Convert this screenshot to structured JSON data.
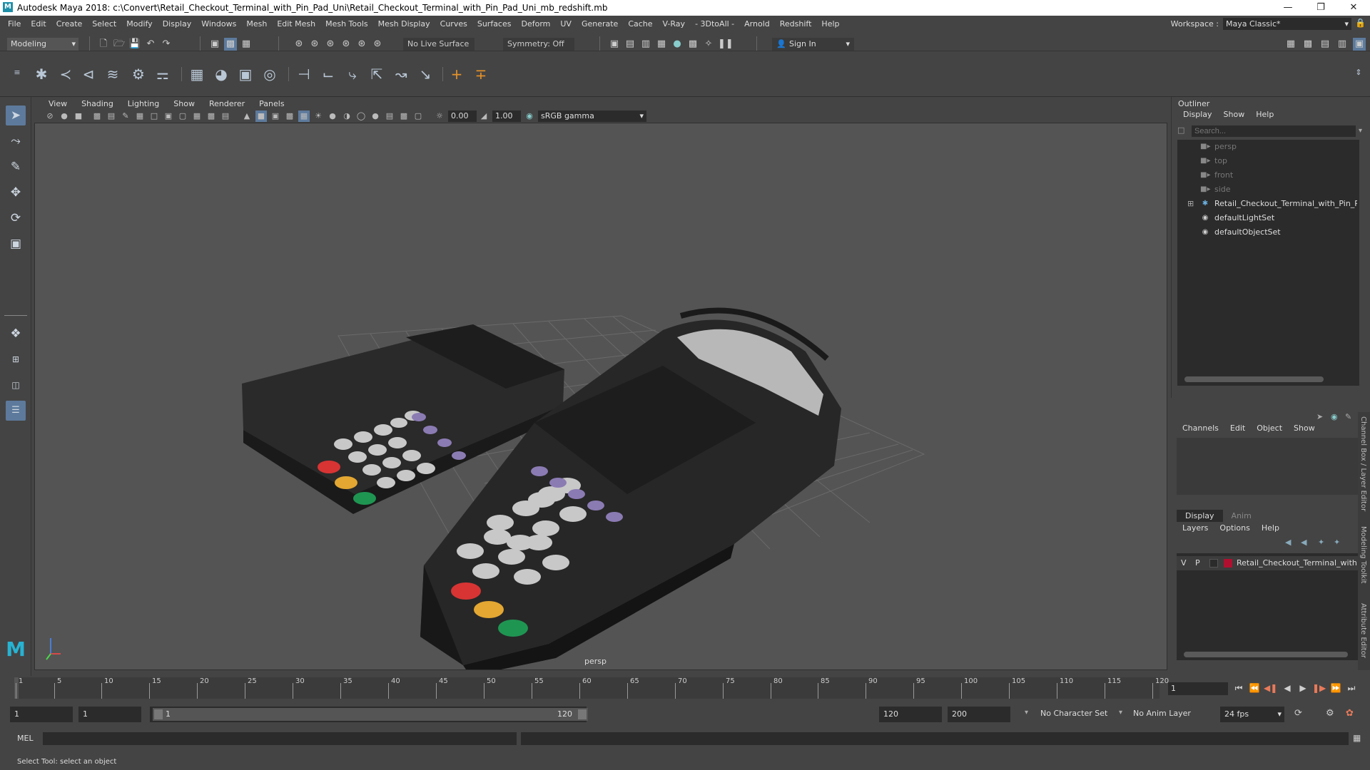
{
  "window": {
    "title": "Autodesk Maya 2018: c:\\Convert\\Retail_Checkout_Terminal_with_Pin_Pad_Uni\\Retail_Checkout_Terminal_with_Pin_Pad_Uni_mb_redshift.mb"
  },
  "menubar": {
    "items": [
      "File",
      "Edit",
      "Create",
      "Select",
      "Modify",
      "Display",
      "Windows",
      "Mesh",
      "Edit Mesh",
      "Mesh Tools",
      "Mesh Display",
      "Curves",
      "Surfaces",
      "Deform",
      "UV",
      "Generate",
      "Cache",
      "V-Ray",
      "- 3DtoAll -",
      "Arnold",
      "Redshift",
      "Help"
    ],
    "workspace_label": "Workspace :",
    "workspace_value": "Maya Classic*"
  },
  "statusline": {
    "mode": "Modeling",
    "live_surface": "No Live Surface",
    "symmetry": "Symmetry: Off",
    "sign_in": "Sign In"
  },
  "viewport": {
    "menu": [
      "View",
      "Shading",
      "Lighting",
      "Show",
      "Renderer",
      "Panels"
    ],
    "exposure": "0.00",
    "gamma": "1.00",
    "color_space": "sRGB gamma",
    "camera": "persp"
  },
  "outliner": {
    "title": "Outliner",
    "menu": [
      "Display",
      "Show",
      "Help"
    ],
    "search_placeholder": "Search...",
    "items": [
      {
        "label": "persp",
        "icon": "camera-icon",
        "dim": true
      },
      {
        "label": "top",
        "icon": "camera-icon",
        "dim": true
      },
      {
        "label": "front",
        "icon": "camera-icon",
        "dim": true
      },
      {
        "label": "side",
        "icon": "camera-icon",
        "dim": true
      },
      {
        "label": "Retail_Checkout_Terminal_with_Pin_Pad_",
        "icon": "group-icon",
        "dim": false
      },
      {
        "label": "defaultLightSet",
        "icon": "set-icon",
        "dim": false
      },
      {
        "label": "defaultObjectSet",
        "icon": "set-icon",
        "dim": false
      }
    ]
  },
  "channelbox": {
    "menu": [
      "Channels",
      "Edit",
      "Object",
      "Show"
    ]
  },
  "layers": {
    "tabs": [
      "Display",
      "Anim"
    ],
    "menu": [
      "Layers",
      "Options",
      "Help"
    ],
    "row": {
      "v": "V",
      "p": "P",
      "name": "Retail_Checkout_Terminal_with",
      "color": "#b01030"
    }
  },
  "side_tabs": [
    "Channel Box / Layer Editor",
    "Modeling Toolkit",
    "Attribute Editor"
  ],
  "timeslider": {
    "ticks": [
      "1",
      "5",
      "10",
      "15",
      "20",
      "25",
      "30",
      "35",
      "40",
      "45",
      "50",
      "55",
      "60",
      "65",
      "70",
      "75",
      "80",
      "85",
      "90",
      "95",
      "100",
      "105",
      "110",
      "115",
      "120"
    ],
    "current_frame": "1"
  },
  "rangeslider": {
    "start": "1",
    "playback_start": "1",
    "range_start": "1",
    "range_end": "120",
    "playback_end": "120",
    "end": "200",
    "character_set": "No Character Set",
    "anim_layer": "No Anim Layer",
    "fps": "24 fps"
  },
  "cmdline": {
    "label": "MEL"
  },
  "helpline": {
    "text": "Select Tool: select an object"
  }
}
